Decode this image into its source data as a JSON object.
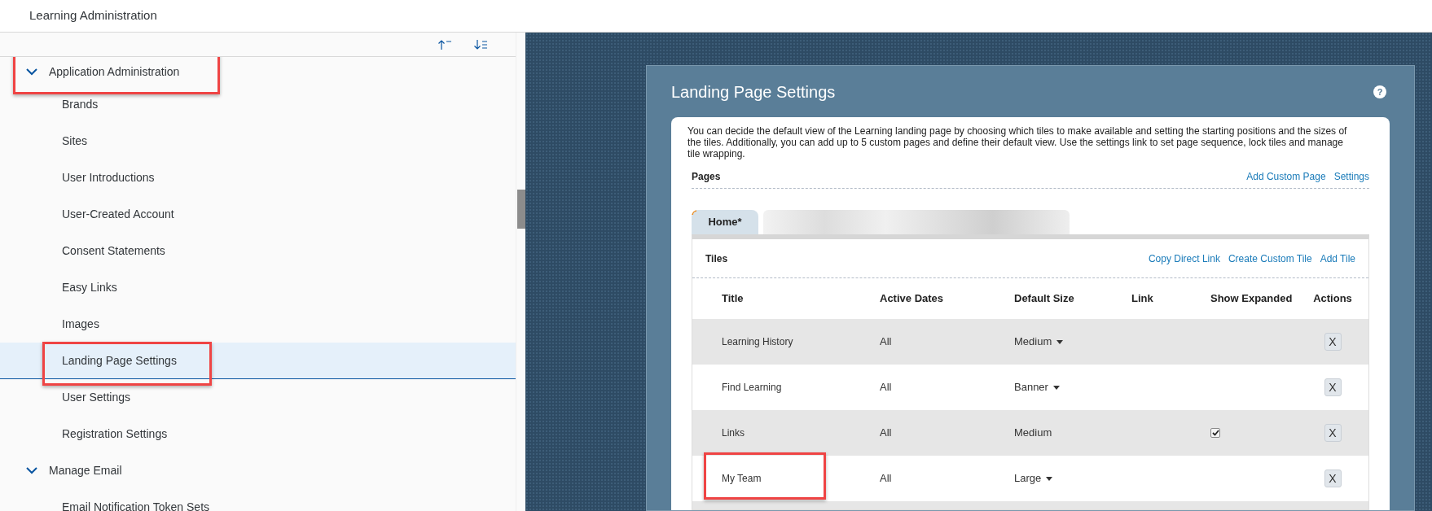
{
  "header": {
    "title": "Learning Administration"
  },
  "tree": [
    {
      "label": "Application Administration",
      "expanded": true,
      "selected": false,
      "annotated": true,
      "children": [
        {
          "label": "Brands",
          "selected": false,
          "annotated": false
        },
        {
          "label": "Sites",
          "selected": false,
          "annotated": false
        },
        {
          "label": "User Introductions",
          "selected": false,
          "annotated": false
        },
        {
          "label": "User-Created Account",
          "selected": false,
          "annotated": false
        },
        {
          "label": "Consent Statements",
          "selected": false,
          "annotated": false
        },
        {
          "label": "Easy Links",
          "selected": false,
          "annotated": false
        },
        {
          "label": "Images",
          "selected": false,
          "annotated": false
        },
        {
          "label": "Landing Page Settings",
          "selected": true,
          "annotated": true
        },
        {
          "label": "User Settings",
          "selected": false,
          "annotated": false
        },
        {
          "label": "Registration Settings",
          "selected": false,
          "annotated": false
        }
      ]
    },
    {
      "label": "Manage Email",
      "expanded": true,
      "selected": false,
      "annotated": false,
      "children": [
        {
          "label": "Email Notification Token Sets",
          "selected": false,
          "annotated": false
        }
      ]
    }
  ],
  "dialog": {
    "title": "Landing Page Settings",
    "help": "?",
    "description": "You can decide the default view of the Learning landing page by choosing which tiles to make available and setting the starting positions and the sizes of the tiles. Additionally, you can add up to 5 custom pages and define their default view. Use the settings link to set page sequence, lock tiles and manage tile wrapping.",
    "pages_heading": "Pages",
    "pages_links": [
      "Add Custom Page",
      "Settings"
    ],
    "tabs": [
      {
        "label": "Home*",
        "selected": true
      }
    ],
    "tiles_heading": "Tiles",
    "tiles_links": [
      "Copy Direct Link",
      "Create Custom Tile",
      "Add Tile"
    ],
    "columns": [
      "Title",
      "Active Dates",
      "Default Size",
      "Link",
      "Show Expanded",
      "Actions"
    ],
    "rows": [
      {
        "title": "Learning History",
        "active_dates": "All",
        "size": "Medium",
        "size_dropdown": true,
        "show_expanded": false,
        "action": "X",
        "annotated": false
      },
      {
        "title": "Find Learning",
        "active_dates": "All",
        "size": "Banner",
        "size_dropdown": true,
        "show_expanded": false,
        "action": "X",
        "annotated": false
      },
      {
        "title": "Links",
        "active_dates": "All",
        "size": "Medium",
        "size_dropdown": false,
        "show_expanded": true,
        "action": "X",
        "annotated": false
      },
      {
        "title": "My Team",
        "active_dates": "All",
        "size": "Large",
        "size_dropdown": true,
        "show_expanded": false,
        "action": "X",
        "annotated": true
      }
    ]
  }
}
